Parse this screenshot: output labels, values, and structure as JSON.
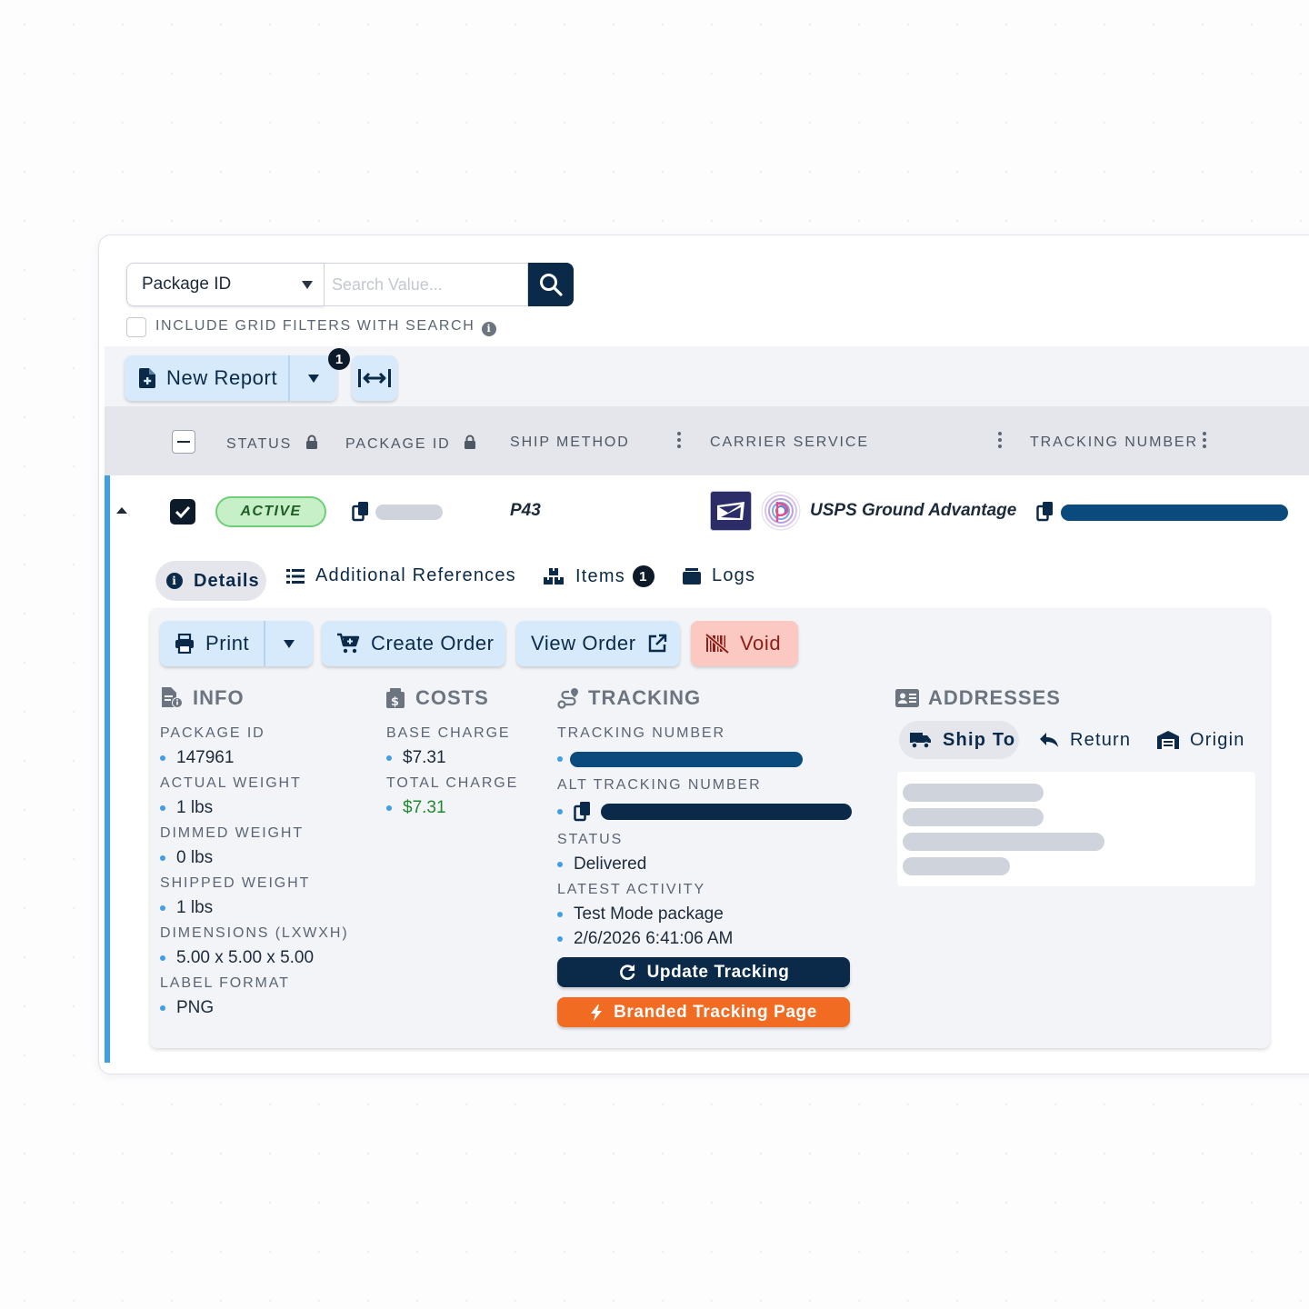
{
  "search": {
    "field_select": "Package ID",
    "placeholder": "Search Value...",
    "include_filters_label": "INCLUDE GRID FILTERS WITH SEARCH"
  },
  "toolbar": {
    "new_report_label": "New Report",
    "report_badge_count": "1"
  },
  "grid": {
    "columns": [
      "STATUS",
      "PACKAGE ID",
      "SHIP METHOD",
      "CARRIER SERVICE",
      "TRACKING NUMBER"
    ],
    "row": {
      "status": "ACTIVE",
      "ship_method": "P43",
      "carrier_service": "USPS Ground Advantage"
    }
  },
  "detail_tabs": {
    "details": "Details",
    "additional_references": "Additional References",
    "items": "Items",
    "items_count": "1",
    "logs": "Logs"
  },
  "actions": {
    "print": "Print",
    "create_order": "Create Order",
    "view_order": "View Order",
    "void": "Void"
  },
  "info": {
    "title": "INFO",
    "fields": [
      {
        "label": "PACKAGE ID",
        "value": "147961"
      },
      {
        "label": "ACTUAL WEIGHT",
        "value": "1 lbs"
      },
      {
        "label": "DIMMED WEIGHT",
        "value": "0 lbs"
      },
      {
        "label": "SHIPPED WEIGHT",
        "value": "1 lbs"
      },
      {
        "label": "DIMENSIONS (LXWXH)",
        "value": "5.00 x 5.00 x 5.00"
      },
      {
        "label": "LABEL FORMAT",
        "value": "PNG"
      }
    ]
  },
  "costs": {
    "title": "COSTS",
    "base_charge_label": "BASE CHARGE",
    "base_charge": "$7.31",
    "total_charge_label": "TOTAL CHARGE",
    "total_charge": "$7.31",
    "total_color": "#1f8a2a"
  },
  "tracking": {
    "title": "TRACKING",
    "tracking_number_label": "TRACKING NUMBER",
    "alt_tracking_number_label": "ALT TRACKING NUMBER",
    "status_label": "STATUS",
    "status": "Delivered",
    "latest_activity_label": "LATEST ACTIVITY",
    "latest_activity": "Test Mode package",
    "latest_activity_time": "2/6/2026 6:41:06 AM",
    "update_button": "Update Tracking",
    "branded_button": "Branded Tracking Page"
  },
  "addresses": {
    "title": "ADDRESSES",
    "tabs": [
      "Ship To",
      "Return",
      "Origin"
    ]
  },
  "colors": {
    "navy": "#0b2a4a",
    "accent_blue": "#3f9fe6",
    "button_light": "#d6eafb",
    "void_bg": "#fbc9c1",
    "active_green": "#c8f0c8",
    "orange": "#f26b22"
  }
}
